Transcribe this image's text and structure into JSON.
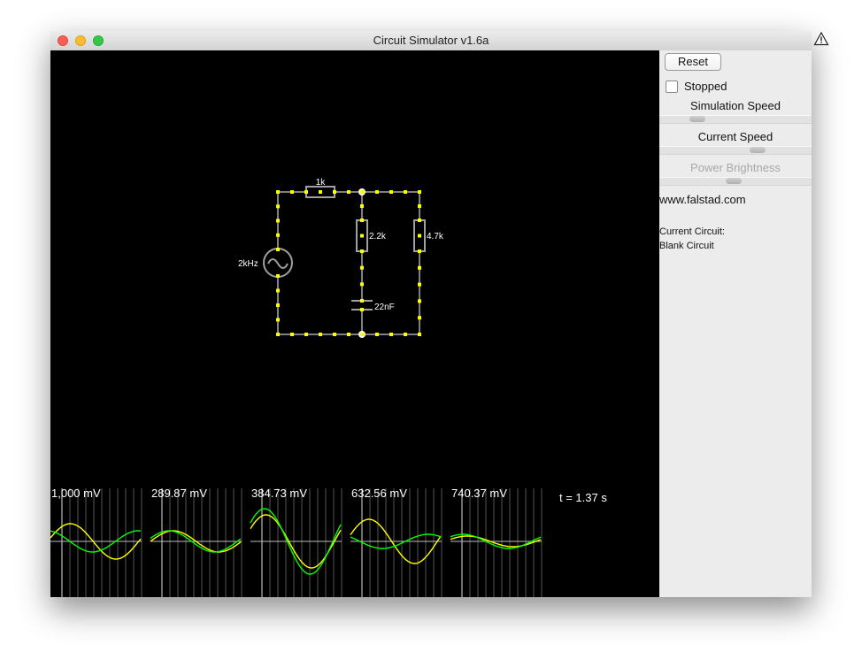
{
  "window": {
    "title": "Circuit Simulator v1.6a"
  },
  "titlebar": {
    "close_icon": "close-traffic-light",
    "minimize_icon": "minimize-traffic-light",
    "zoom_icon": "zoom-traffic-light",
    "warning_icon": "warning-triangle-icon"
  },
  "panel": {
    "reset_label": "Reset",
    "stopped_label": "Stopped",
    "stopped_checked": false,
    "sim_speed_label": "Simulation Speed",
    "sim_speed_value": 0.22,
    "current_speed_label": "Current Speed",
    "current_speed_value": 0.66,
    "power_brightness_label": "Power Brightness",
    "power_brightness_value": 0.49,
    "power_brightness_enabled": false,
    "website": "www.falstad.com",
    "current_circuit_label": "Current Circuit:",
    "current_circuit_name": "Blank Circuit"
  },
  "circuit": {
    "resistor1_label": "1k",
    "resistor2_label": "2.2k",
    "resistor3_label": "4.7k",
    "capacitor_label": "22nF",
    "source_label": "2kHz",
    "wire_color": "#808080",
    "current_dot_color": "#ffff00",
    "node_color": "#ffffff"
  },
  "scopes": {
    "time_label": "t = 1.37 s",
    "voltage_color": "#00ff00",
    "current_color": "#ffff00",
    "grid_color": "#555555",
    "items": [
      {
        "label": "1,000 mV"
      },
      {
        "label": "289.87 mV"
      },
      {
        "label": "384.73 mV"
      },
      {
        "label": "632.56 mV"
      },
      {
        "label": "740.37 mV"
      }
    ]
  }
}
